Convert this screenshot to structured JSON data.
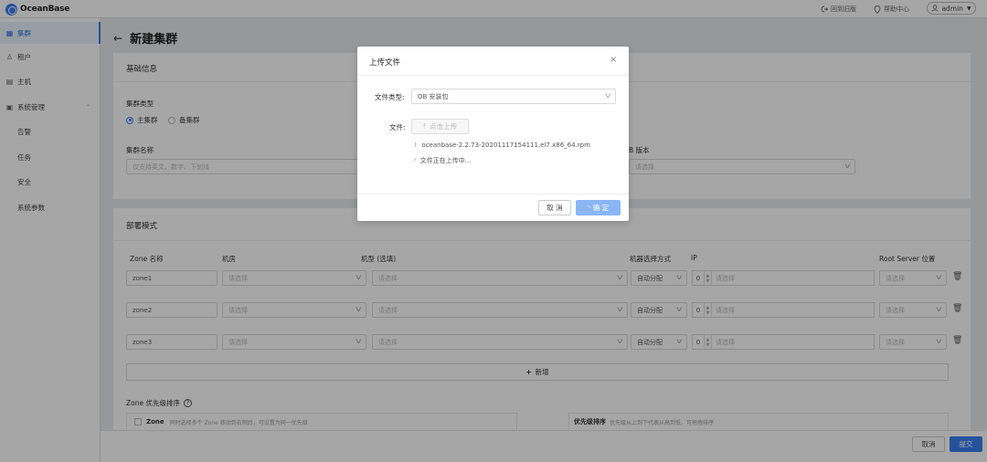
{
  "header": {
    "logo_text": "OceanBase",
    "links": [
      {
        "label": "回到旧版",
        "icon": "exit-icon"
      },
      {
        "label": "帮助中心",
        "icon": "help-pin-icon"
      }
    ],
    "user": {
      "label": "admin",
      "icon": "user-icon"
    }
  },
  "sidebar": {
    "items": [
      {
        "label": "集群",
        "icon": "cluster-icon",
        "active": true
      },
      {
        "label": "租户",
        "icon": "tenant-icon"
      },
      {
        "label": "主机",
        "icon": "host-icon"
      },
      {
        "label": "系统管理",
        "icon": "system-icon",
        "expanded": true
      }
    ],
    "sub_items": [
      "告警",
      "任务",
      "安全",
      "系统参数"
    ]
  },
  "page": {
    "title": "新建集群",
    "basic": {
      "section_title": "基础信息",
      "cluster_type_label": "集群类型",
      "cluster_type_options": [
        "主集群",
        "备集群"
      ],
      "cluster_type_selected": "主集群",
      "cluster_name_label": "集群名称",
      "cluster_name_placeholder": "仅支持英文、数字、下划线",
      "version_label": "B 版本",
      "version_placeholder": "请选择"
    },
    "deploy": {
      "section_title": "部署模式",
      "columns": [
        "Zone 名称",
        "机房",
        "机型 (选填)",
        "机器选择方式",
        "IP",
        "Root Server 位置"
      ],
      "zones": [
        {
          "name": "zone1",
          "room": "请选择",
          "model": "请选择",
          "mode": "自动分配",
          "count": "0",
          "ip": "请选择",
          "rs": "请选择"
        },
        {
          "name": "zone2",
          "room": "请选择",
          "model": "请选择",
          "mode": "自动分配",
          "count": "0",
          "ip": "请选择",
          "rs": "请选择"
        },
        {
          "name": "zone3",
          "room": "请选择",
          "model": "请选择",
          "mode": "自动分配",
          "count": "0",
          "ip": "请选择",
          "rs": "请选择"
        }
      ],
      "add_label": "新增",
      "priority_title": "Zone 优先级排序",
      "priority_left_title": "Zone",
      "priority_left_hint": "同时选择多个 Zone 移动到右侧后，可设置为同一优先级",
      "priority_right_title": "优先级排序",
      "priority_right_hint": "优先级从上到下代表从高到低，可拖拽排序"
    }
  },
  "footer": {
    "cancel": "取消",
    "submit": "提交"
  },
  "modal": {
    "title": "上传文件",
    "file_type_label": "文件类型:",
    "file_type_value": "OB 安装包",
    "file_label": "文件:",
    "upload_button": "点击上传",
    "file_name": "oceanbase-2.2.73-20201117154111.el7.x86_64.rpm",
    "status": "文件正在上传中...",
    "cancel": "取 消",
    "ok": "确 定"
  }
}
